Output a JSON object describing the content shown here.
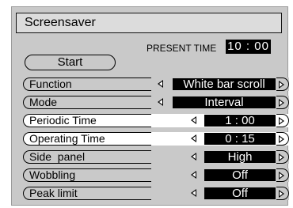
{
  "title": "Screensaver",
  "present_time": {
    "label": "PRESENT TIME",
    "value": "10 : 00"
  },
  "start_button": "Start",
  "rows": [
    {
      "label": "Function",
      "value": "White bar scroll"
    },
    {
      "label": "Mode",
      "value": "Interval"
    },
    {
      "label": "Periodic Time",
      "value": "1 : 00"
    },
    {
      "label": "Operating Time",
      "value": "0 : 15"
    },
    {
      "label": "Side  panel",
      "value": "High"
    },
    {
      "label": "Wobbling",
      "value": "Off"
    },
    {
      "label": "Peak limit",
      "value": "Off"
    }
  ]
}
